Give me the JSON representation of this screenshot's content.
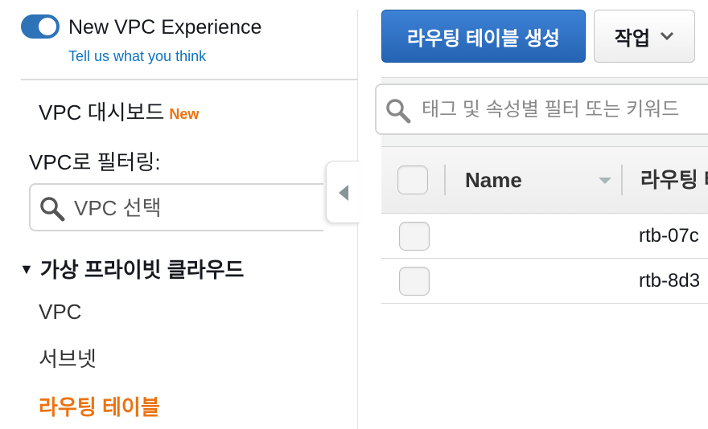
{
  "sidebar": {
    "experience_toggle_label": "New VPC Experience",
    "experience_toggle_on": true,
    "feedback_link": "Tell us what you think",
    "dashboard_label": "VPC 대시보드",
    "dashboard_badge": "New",
    "filter_label": "VPC로 필터링:",
    "vpc_select_placeholder": "VPC 선택",
    "section_title": "가상 프라이빗 클라우드",
    "items": [
      {
        "label": "VPC"
      },
      {
        "label": "서브넷"
      },
      {
        "label": "라우팅 테이블"
      }
    ],
    "active_item": "라우팅 테이블"
  },
  "toolbar": {
    "create_button": "라우팅 테이블 생성",
    "actions_button": "작업"
  },
  "table": {
    "search_placeholder": "태그 및 속성별 필터 또는 키워드",
    "columns": [
      "Name",
      "라우팅 테"
    ],
    "rows": [
      {
        "name": "",
        "route_table_id": "rtb-07c"
      },
      {
        "name": "",
        "route_table_id": "rtb-8d3"
      }
    ]
  },
  "colors": {
    "primary_blue": "#2563b3",
    "active_orange": "#ec7211",
    "link_blue": "#0f73c2"
  }
}
